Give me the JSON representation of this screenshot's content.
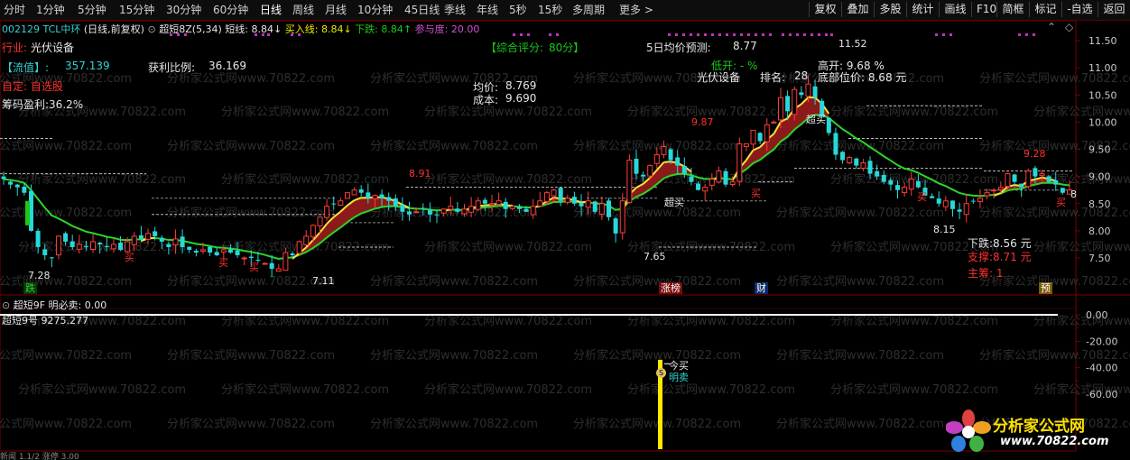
{
  "toolbar": {
    "periods": [
      "分时",
      "1分钟",
      "5分钟",
      "15分钟",
      "30分钟",
      "60分钟",
      "日线",
      "周线",
      "月线",
      "10分钟",
      "45日线",
      "季线",
      "年线",
      "5秒",
      "15秒",
      "多周期",
      "更多"
    ],
    "active_period": "日线",
    "right_buttons": [
      "复权",
      "叠加",
      "多股",
      "统计",
      "画线",
      "F10",
      "简框",
      "标记",
      "-自选",
      "返回"
    ]
  },
  "header": {
    "code": "002129",
    "name": "TCL中环",
    "mode": "(日线,前复权)",
    "indicator": "超短8Z(5,34)",
    "short_line_label": "短线:",
    "short_line_value": "8.84↓",
    "buy_line_label": "买入线:",
    "buy_line_value": "8.84↓",
    "fall_label": "下跌:",
    "fall_value": "8.84↑",
    "participation_label": "参与度:",
    "participation_value": "20.00"
  },
  "info": {
    "industry_label": "行业:",
    "industry": "光伏设备",
    "score_label": "【综合评分:",
    "score": "80分】",
    "forecast_label": "5日均价预测:",
    "forecast": "8.77",
    "float_label": "【流值】:",
    "float_value": "357.139",
    "profit_label": "获利比例:",
    "profit_value": "36.169",
    "custom": "自定: 自选股",
    "chip_profit": "筹码盈利:36.2%",
    "avg_label": "均价:",
    "avg_value": "8.769",
    "cost_label": "成本:",
    "cost_value": "9.690",
    "low_open": "低开: - %",
    "sector": "光伏设备",
    "rank_label": "排名:",
    "rank_value": "28",
    "high_open": "高开: 9.68 %",
    "bottom_price": "底部位价: 8.68 元",
    "fall_price": "下跌:8.56 元",
    "support": "支撑:8.71 元",
    "main": "主筹: 1"
  },
  "price_marks": {
    "p_11_52": "11.52",
    "p_9_87": "9.87",
    "p_9_28": "9.28",
    "p_8_91": "8.91",
    "p_8_15": "8.15",
    "p_7_65": "7.65",
    "p_7_28": "7.28",
    "p_7_11": "7.11",
    "p_8_tail": "8"
  },
  "signals": {
    "buy": "买",
    "super_buy": "超买",
    "die": "跌",
    "zhang_bang": "涨榜",
    "cai": "财",
    "yu": "预"
  },
  "lower_panel": {
    "title": "超短9F",
    "sell_label": "明必卖:",
    "sell_value": "0.00",
    "value_label": "超短9号",
    "value": "9275.277",
    "today_buy": "今买",
    "tomorrow_sell": "明卖",
    "badge": "S"
  },
  "watermark": "分析家公式网www.70822.com",
  "logo": {
    "text": "分析家公式网",
    "url": "www.70822.com"
  },
  "footer": "新闻 1.1/2 涨停 3.00",
  "chart_data": {
    "type": "candlestick",
    "ylim_upper": [
      7.1,
      11.8
    ],
    "y_ticks_upper": [
      11.5,
      11.0,
      10.5,
      10.0,
      9.5,
      9.0,
      8.5,
      8.0,
      7.5
    ],
    "y_ticks_lower": [
      0.0,
      -20.0,
      -40.0,
      -60.0
    ],
    "ylim_lower": [
      -65,
      5
    ],
    "closes": [
      8.95,
      8.85,
      8.8,
      8.7,
      8.0,
      7.7,
      7.55,
      7.5,
      7.9,
      7.8,
      7.7,
      7.75,
      7.7,
      7.8,
      7.75,
      7.7,
      7.75,
      7.65,
      7.8,
      7.9,
      7.85,
      7.95,
      7.9,
      7.8,
      7.7,
      7.85,
      7.7,
      7.65,
      7.6,
      7.65,
      7.6,
      7.55,
      7.65,
      7.6,
      7.55,
      7.5,
      7.5,
      7.45,
      7.4,
      7.3,
      7.3,
      7.6,
      7.55,
      7.8,
      7.9,
      8.1,
      8.25,
      8.45,
      8.5,
      8.55,
      8.7,
      8.75,
      8.7,
      8.6,
      8.65,
      8.6,
      8.55,
      8.45,
      8.35,
      8.3,
      8.35,
      8.4,
      8.3,
      8.3,
      8.4,
      8.45,
      8.35,
      8.4,
      8.45,
      8.55,
      8.5,
      8.5,
      8.55,
      8.4,
      8.45,
      8.4,
      8.35,
      8.45,
      8.55,
      8.7,
      8.75,
      8.55,
      8.6,
      8.5,
      8.45,
      8.55,
      8.35,
      8.5,
      8.25,
      7.95,
      8.55,
      9.3,
      9.05,
      9.0,
      9.2,
      9.4,
      9.55,
      9.3,
      9.2,
      9.05,
      8.9,
      8.75,
      8.8,
      8.95,
      9.1,
      8.85,
      8.9,
      9.6,
      9.6,
      9.85,
      9.65,
      9.95,
      10.0,
      10.45,
      10.2,
      10.6,
      10.5,
      10.7,
      10.45,
      10.1,
      9.8,
      9.4,
      9.3,
      9.35,
      9.2,
      9.25,
      9.05,
      9.0,
      8.9,
      8.85,
      8.75,
      8.8,
      8.95,
      8.8,
      8.65,
      8.6,
      8.5,
      8.55,
      8.4,
      8.35,
      8.5,
      8.55,
      8.6,
      8.7,
      8.75,
      8.8,
      9.05,
      8.9,
      8.8,
      9.1,
      9.0,
      9.05,
      8.9,
      8.85,
      8.7,
      8.75
    ]
  }
}
